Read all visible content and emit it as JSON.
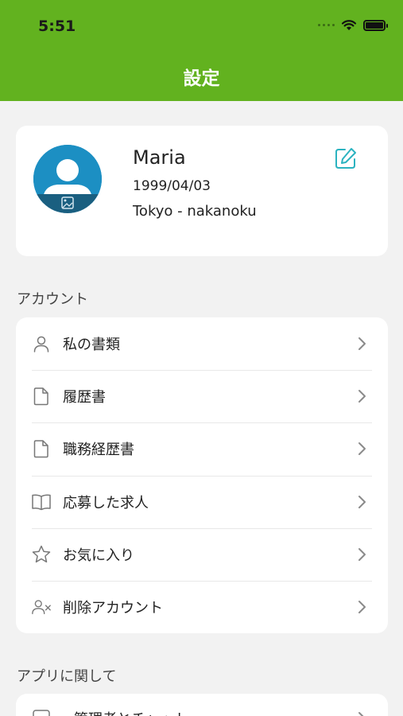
{
  "status_bar": {
    "time": "5:51"
  },
  "header": {
    "title": "設定",
    "background": "#62b21f"
  },
  "profile": {
    "name": "Maria",
    "birthdate": "1999/04/03",
    "location": "Tokyo - nakanoku",
    "avatar_color": "#1c8fc3",
    "edit_icon": "edit-icon"
  },
  "account_section": {
    "label": "アカウント",
    "items": [
      {
        "label": "私の書類",
        "icon": "person-icon"
      },
      {
        "label": "履歴書",
        "icon": "document-icon"
      },
      {
        "label": "職務経歴書",
        "icon": "document-icon"
      },
      {
        "label": "応募した求人",
        "icon": "book-icon"
      },
      {
        "label": "お気に入り",
        "icon": "star-icon"
      },
      {
        "label": "削除アカウント",
        "icon": "remove-user-icon"
      }
    ]
  },
  "app_section": {
    "label": "アプリに関して",
    "items": [
      {
        "label": "管理者とチャット",
        "icon": "chat-icon"
      }
    ]
  }
}
